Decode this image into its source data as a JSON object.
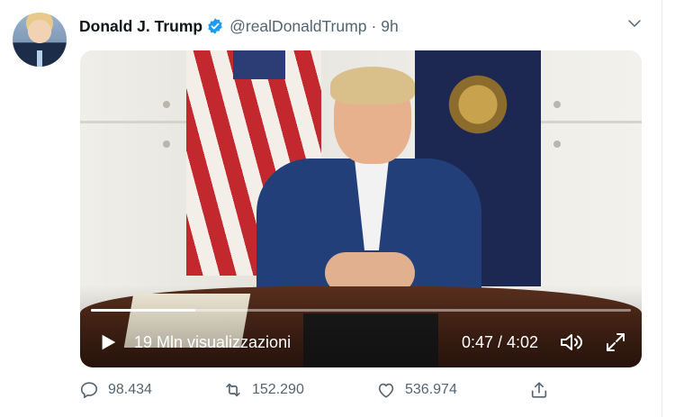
{
  "tweet": {
    "author": {
      "name": "Donald J. Trump",
      "handle": "@realDonaldTrump",
      "separator": "·",
      "timestamp": "9h",
      "avatar": "profile-photo"
    },
    "icons": {
      "verified": "verified-badge-icon",
      "menu": "chevron-down-icon"
    },
    "colors": {
      "text_primary": "#0f1419",
      "text_secondary": "#536471",
      "verified_blue": "#1d9bf0",
      "video_text": "#ffffff"
    }
  },
  "video": {
    "views_label": "19 Mln visualizzazioni",
    "time_label": "0:47 / 4:02",
    "progress": 0.194,
    "icons": {
      "play": "play-icon",
      "volume": "volume-icon",
      "fullscreen": "fullscreen-icon"
    }
  },
  "actions": {
    "reply": {
      "icon": "reply-icon",
      "count": "98.434"
    },
    "retweet": {
      "icon": "retweet-icon",
      "count": "152.290"
    },
    "like": {
      "icon": "heart-icon",
      "count": "536.974"
    },
    "share": {
      "icon": "share-icon"
    }
  }
}
